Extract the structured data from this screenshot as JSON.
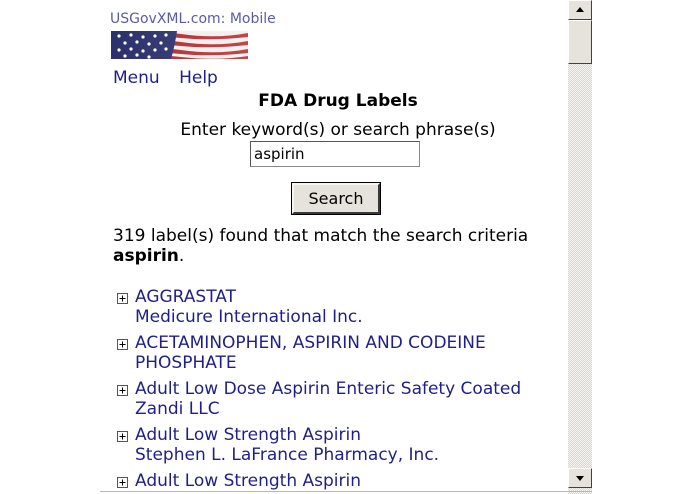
{
  "header": {
    "site_title": "USGovXML.com: Mobile"
  },
  "nav": {
    "menu_label": "Menu",
    "help_label": "Help"
  },
  "page": {
    "title": "FDA Drug Labels",
    "search_label": "Enter keyword(s) or search phrase(s)",
    "search_value": "aspirin",
    "search_button_label": "Search"
  },
  "results_summary": {
    "text": "319 label(s) found that match the search criteria",
    "term": "aspirin",
    "period": "."
  },
  "results": [
    {
      "name": "AGGRASTAT",
      "company": "Medicure International Inc."
    },
    {
      "name": "ACETAMINOPHEN, ASPIRIN AND CODEINE PHOSPHATE",
      "company": ""
    },
    {
      "name": "Adult Low Dose Aspirin Enteric Safety Coated",
      "company": "Zandi LLC"
    },
    {
      "name": "Adult Low Strength Aspirin",
      "company": "Stephen L. LaFrance Pharmacy, Inc."
    },
    {
      "name": "Adult Low Strength Aspirin",
      "company": ""
    }
  ],
  "icons": {
    "expand": "plus-box-icon",
    "scroll_up": "arrow-up-icon",
    "scroll_down": "arrow-down-icon",
    "flag": "us-flag-icon"
  },
  "colors": {
    "link": "#1f1f8c",
    "site_title": "#5a5aa8"
  }
}
